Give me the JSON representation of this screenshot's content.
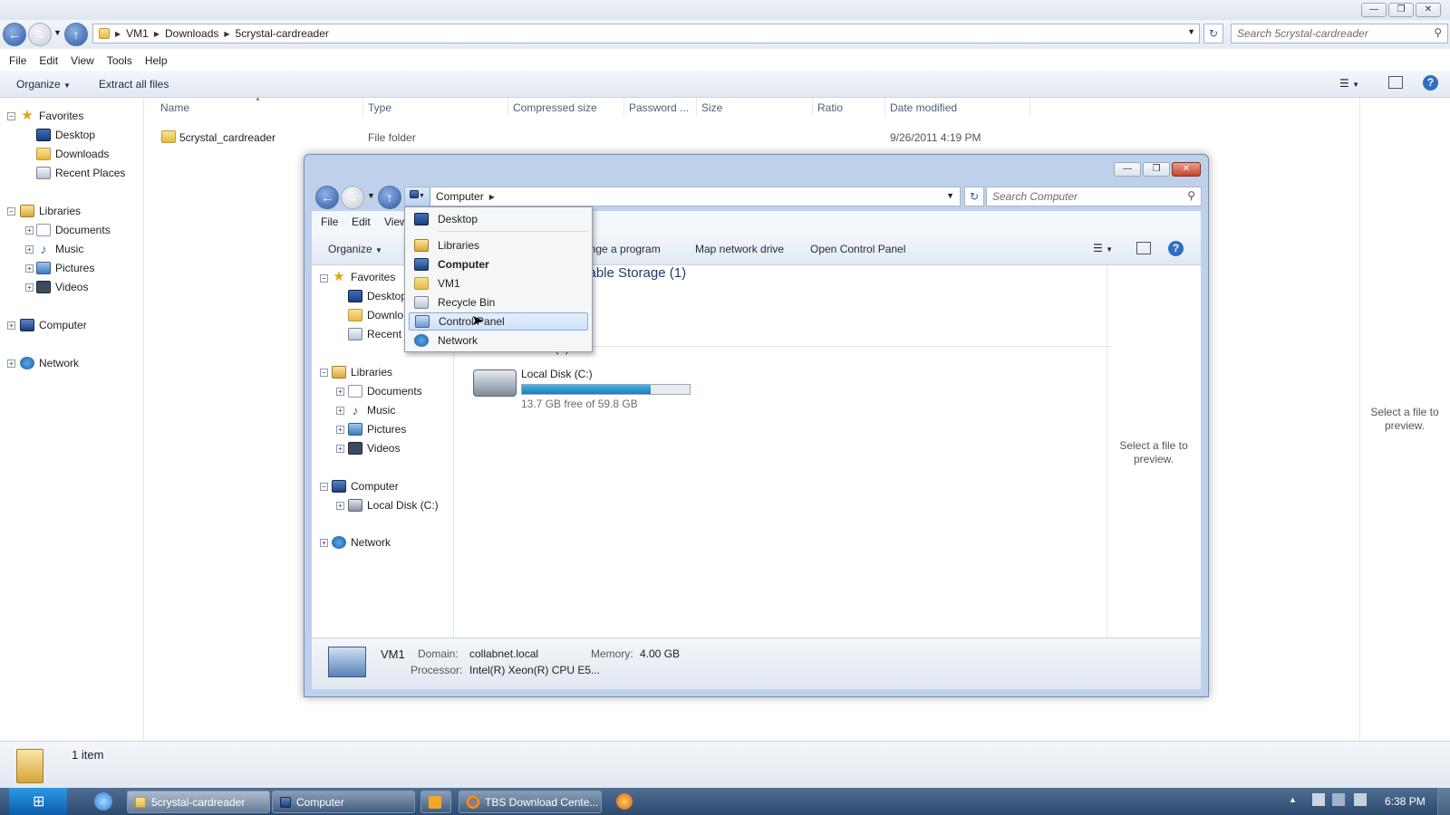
{
  "outer": {
    "breadcrumb": [
      "VM1",
      "Downloads",
      "5crystal-cardreader"
    ],
    "search_placeholder": "Search 5crystal-cardreader",
    "menu": [
      "File",
      "Edit",
      "View",
      "Tools",
      "Help"
    ],
    "toolbar": {
      "organize": "Organize",
      "extract": "Extract all files"
    },
    "tree": {
      "favorites": "Favorites",
      "desktop": "Desktop",
      "downloads": "Downloads",
      "recent": "Recent Places",
      "libraries": "Libraries",
      "documents": "Documents",
      "music": "Music",
      "pictures": "Pictures",
      "videos": "Videos",
      "computer": "Computer",
      "network": "Network"
    },
    "columns": [
      "Name",
      "Type",
      "Compressed size",
      "Password ...",
      "Size",
      "Ratio",
      "Date modified"
    ],
    "rows": [
      {
        "name": "5crystal_cardreader",
        "type": "File folder",
        "date": "9/26/2011 4:19 PM"
      }
    ],
    "preview": "Select a file to preview.",
    "status": "1 item"
  },
  "inner": {
    "breadcrumb": "Computer",
    "search_placeholder": "Search Computer",
    "menu": [
      "File",
      "Edit",
      "View"
    ],
    "toolbar": {
      "organize": "Organize",
      "change_program": "ange a program",
      "map_drive": "Map network drive",
      "control_panel": "Open Control Panel"
    },
    "tree": {
      "favorites": "Favorites",
      "desktop": "Desktop",
      "downloads": "Downlo",
      "recent": "Recent",
      "libraries": "Libraries",
      "documents": "Documents",
      "music": "Music",
      "pictures": "Pictures",
      "videos": "Videos",
      "computer": "Computer",
      "local_disk": "Local Disk (C:)",
      "network": "Network"
    },
    "section_removable": "vable Storage (1)",
    "section_hdd": "Hard Disk Drives (1)",
    "disk": {
      "name": "Local Disk (C:)",
      "free": "13.7 GB free of 59.8 GB",
      "used_fraction": 0.77
    },
    "preview": "Select a file to preview.",
    "details": {
      "name": "VM1",
      "domain_label": "Domain:",
      "domain": "collabnet.local",
      "memory_label": "Memory:",
      "memory": "4.00 GB",
      "processor_label": "Processor:",
      "processor": "Intel(R) Xeon(R) CPU E5..."
    }
  },
  "dropdown": {
    "items": [
      "Desktop",
      "Libraries",
      "Computer",
      "VM1",
      "Recycle Bin",
      "Control Panel",
      "Network"
    ],
    "highlighted": "Control Panel"
  },
  "taskbar": {
    "tasks": [
      "5crystal-cardreader",
      "Computer",
      "TBS Download Cente..."
    ],
    "clock": "6:38 PM"
  }
}
